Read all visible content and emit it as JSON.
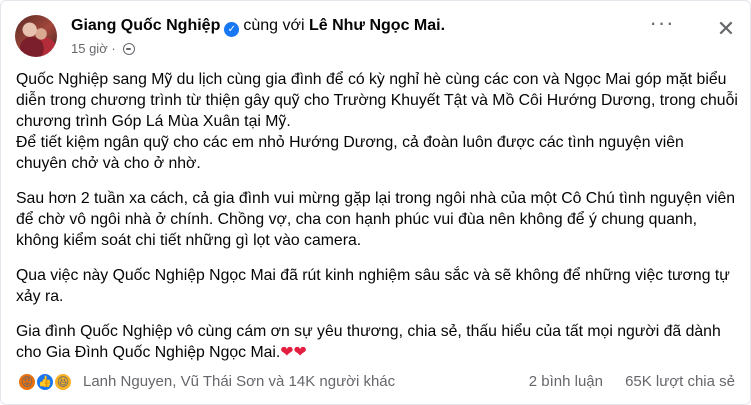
{
  "post": {
    "author": "Giang Quốc Nghiệp",
    "with_text": "cùng với",
    "tagged": "Lê Như Ngọc Mai.",
    "time": "15 giờ",
    "more_label": "···",
    "close_label": "✕",
    "paragraphs": [
      "Quốc Nghiệp sang Mỹ du lịch cùng gia đình để có kỳ nghỉ hè cùng các con và Ngọc Mai góp mặt biểu diễn trong chương trình từ thiện gây quỹ cho Trường Khuyết Tật và Mồ Côi Hướng Dương, trong chuỗi chương trình Góp Lá Mùa Xuân tại Mỹ.\n Để tiết kiệm ngân quỹ cho các em nhỏ Hướng Dương, cả đoàn luôn được các tình nguyện viên chuyên chở và cho ở nhờ.",
      "Sau hơn 2 tuần xa cách, cả gia đình vui mừng gặp lại trong ngôi nhà của một Cô Chú tình nguyện viên để chờ vô ngôi nhà ở chính. Chồng vợ, cha con hạnh phúc vui đùa nên không để ý chung quanh, không kiểm soát chi tiết những gì lọt vào camera.",
      "Qua việc này Quốc Nghiệp Ngọc Mai đã rút kinh nghiệm sâu sắc và sẽ không để những việc tương tự xảy ra.",
      " Gia đình Quốc Nghiệp vô cùng cám ơn sự yêu thương, chia sẻ, thấu hiểu của tất mọi người đã dành cho Gia Đình Quốc Nghiệp Ngọc Mai."
    ],
    "hearts": "❤❤"
  },
  "footer": {
    "reaction_icons": [
      "angry-icon",
      "like-icon",
      "haha-icon"
    ],
    "reactors": "Lanh Nguyen, Vũ Thái Sơn và 14K người khác",
    "comments": "2 bình luận",
    "shares": "65K lượt chia sẻ"
  },
  "colors": {
    "verified": "#1877f2",
    "secondary_text": "#65676b",
    "heart": "#e41e3f"
  }
}
